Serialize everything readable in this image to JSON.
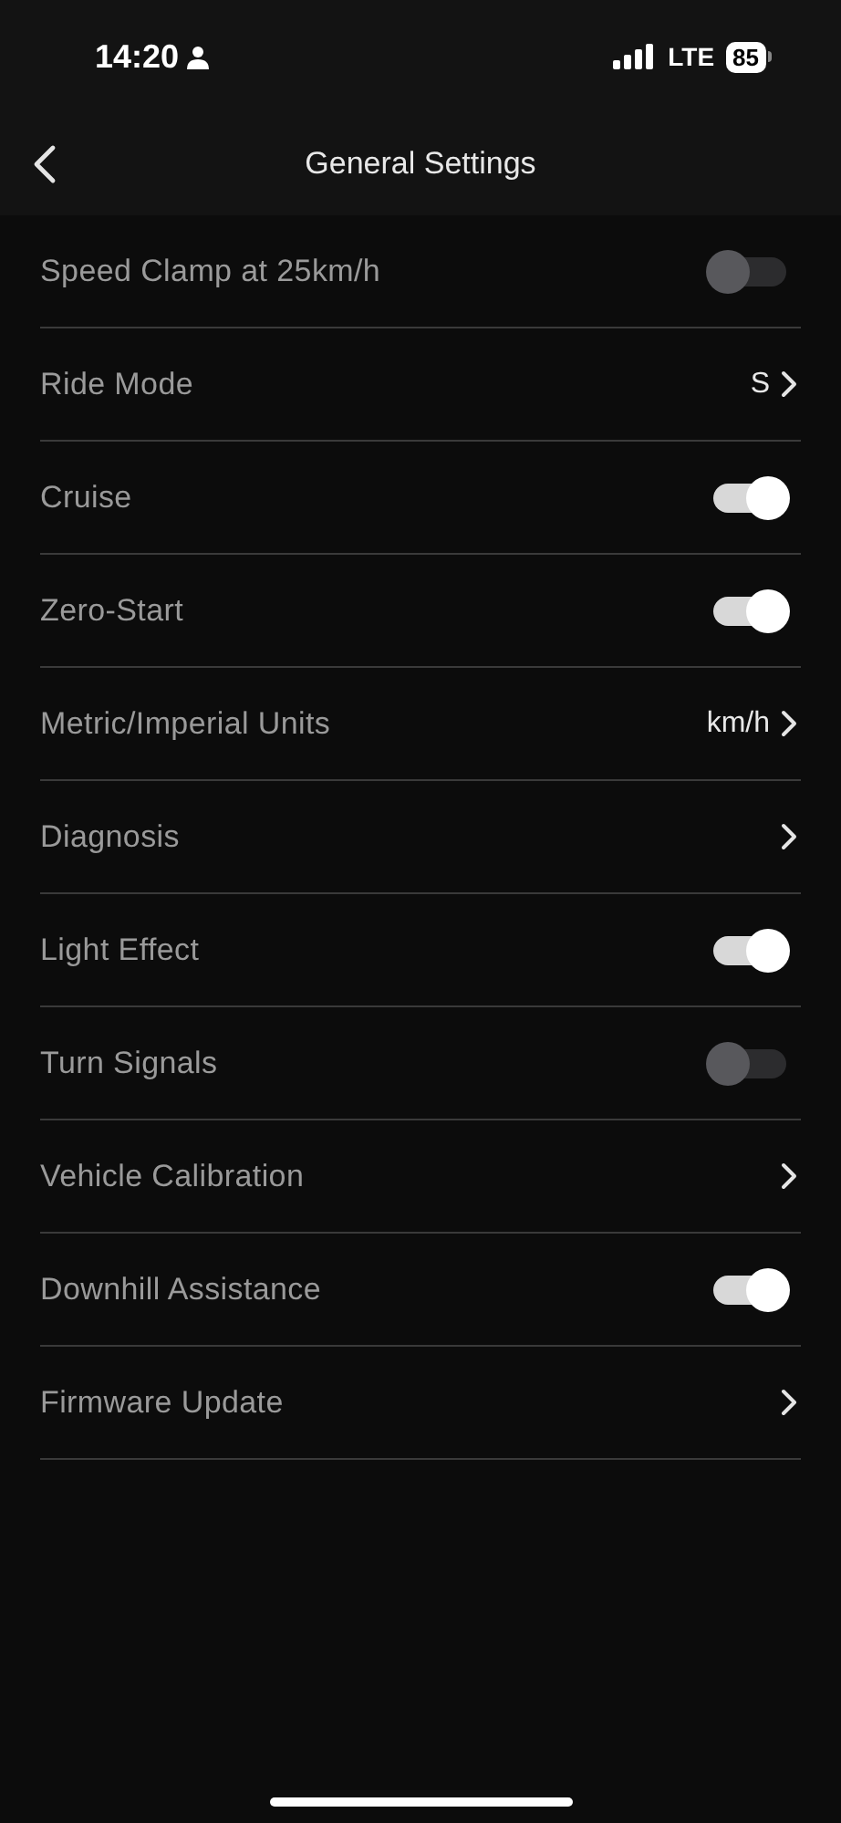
{
  "status_bar": {
    "time": "14:20",
    "network": "LTE",
    "battery": "85"
  },
  "header": {
    "title": "General Settings"
  },
  "settings": [
    {
      "kind": "toggle",
      "label": "Speed Clamp at 25km/h",
      "on": false
    },
    {
      "kind": "link",
      "label": "Ride Mode",
      "value": "S"
    },
    {
      "kind": "toggle",
      "label": "Cruise",
      "on": true
    },
    {
      "kind": "toggle",
      "label": "Zero-Start",
      "on": true
    },
    {
      "kind": "link",
      "label": "Metric/Imperial Units",
      "value": "km/h"
    },
    {
      "kind": "link",
      "label": "Diagnosis"
    },
    {
      "kind": "toggle",
      "label": "Light Effect",
      "on": true
    },
    {
      "kind": "toggle",
      "label": "Turn Signals",
      "on": false
    },
    {
      "kind": "link",
      "label": "Vehicle Calibration"
    },
    {
      "kind": "toggle",
      "label": "Downhill Assistance",
      "on": true
    },
    {
      "kind": "link",
      "label": "Firmware Update"
    }
  ]
}
